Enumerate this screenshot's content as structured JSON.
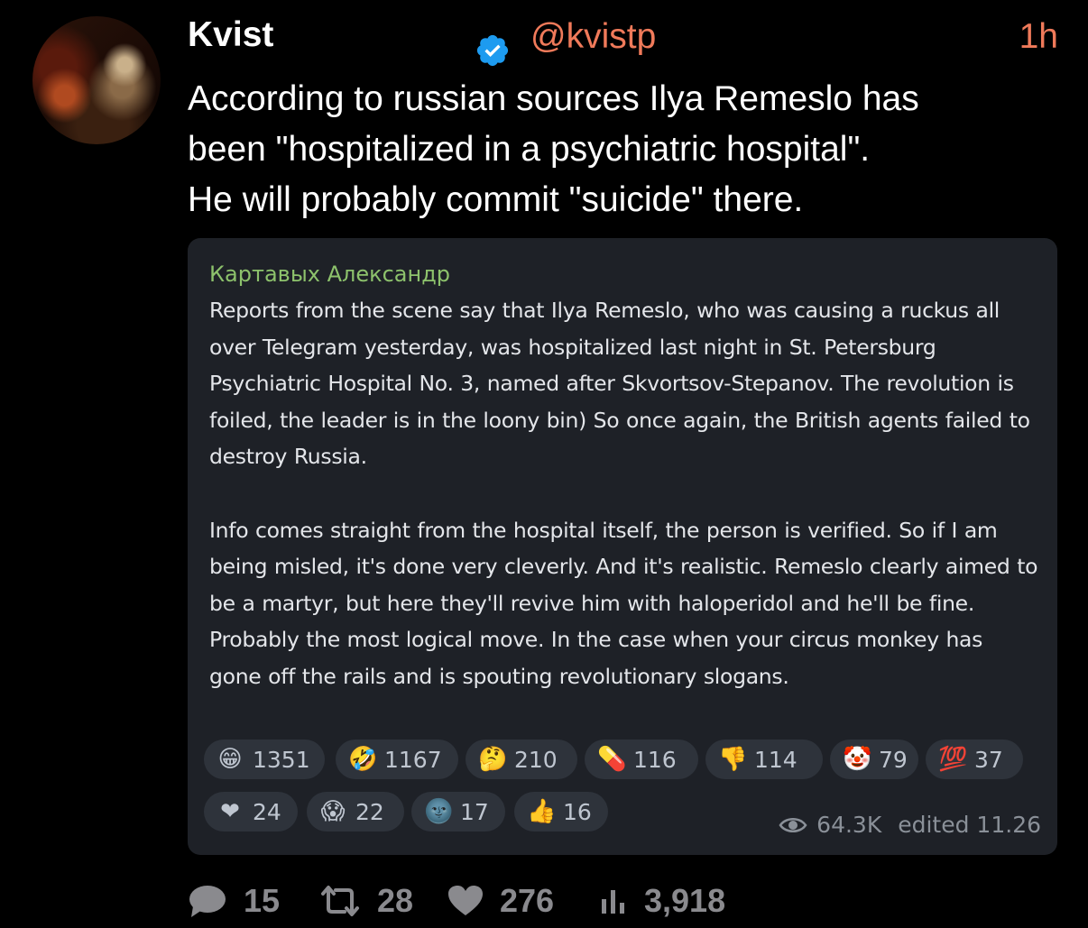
{
  "author": {
    "name": "Kvist",
    "handle": "@kvistp",
    "time": "1h"
  },
  "tweet": {
    "text": "According to russian sources Ilya Remeslo has\nbeen \"hospitalized in a psychiatric hospital\".\nHe will probably commit \"suicide\" there."
  },
  "quote": {
    "author": "Картавых Александр",
    "paragraphs": [
      "Reports from the scene say that Ilya Remeslo, who was causing a ruckus all over Telegram yesterday, was hospitalized last night in St. Petersburg Psychiatric Hospital No. 3, named after Skvortsov-Stepanov. The revolution is foiled, the leader is in the loony bin) So once again, the British agents failed to destroy Russia.",
      "Info comes straight from the hospital itself, the person is verified. So if I am being misled, it's done very cleverly. And it's realistic. Remeslo clearly aimed to be a martyr, but here they'll revive him with haloperidol and he'll be fine. Probably the most logical move. In the case when your circus monkey has gone off the rails and is spouting revolutionary slogans."
    ],
    "reactions_row1": [
      {
        "icon": "grinning-face-icon",
        "glyph": "😁",
        "count": "1351"
      },
      {
        "icon": "rofl-face-icon",
        "glyph": "🤣",
        "count": "1167"
      },
      {
        "icon": "thinking-face-icon",
        "glyph": "🤔",
        "count": "210"
      },
      {
        "icon": "pill-icon",
        "glyph": "💊",
        "count": "116"
      },
      {
        "icon": "thumbs-down-icon",
        "glyph": "👎",
        "count": "114"
      },
      {
        "icon": "clown-face-icon",
        "glyph": "🤡",
        "count": "79"
      },
      {
        "icon": "hundred-points-icon",
        "glyph": "💯",
        "count": "37"
      }
    ],
    "reactions_row2": [
      {
        "icon": "red-heart-icon",
        "glyph": "❤",
        "count": "24"
      },
      {
        "icon": "screaming-face-icon",
        "glyph": "😱",
        "count": "22"
      },
      {
        "icon": "new-moon-face-icon",
        "glyph": "🌚",
        "count": "17"
      },
      {
        "icon": "thumbs-up-icon",
        "glyph": "👍",
        "count": "16"
      }
    ],
    "views": "64.3K",
    "edited": "edited 11.26"
  },
  "actions": {
    "replies": "15",
    "retweets": "28",
    "likes": "276",
    "views": "3,918"
  },
  "colors": {
    "accent": "#f07a5a",
    "verified": "#1d9bf0",
    "card_background": "#1e2127",
    "quote_author": "#8dc26c"
  }
}
